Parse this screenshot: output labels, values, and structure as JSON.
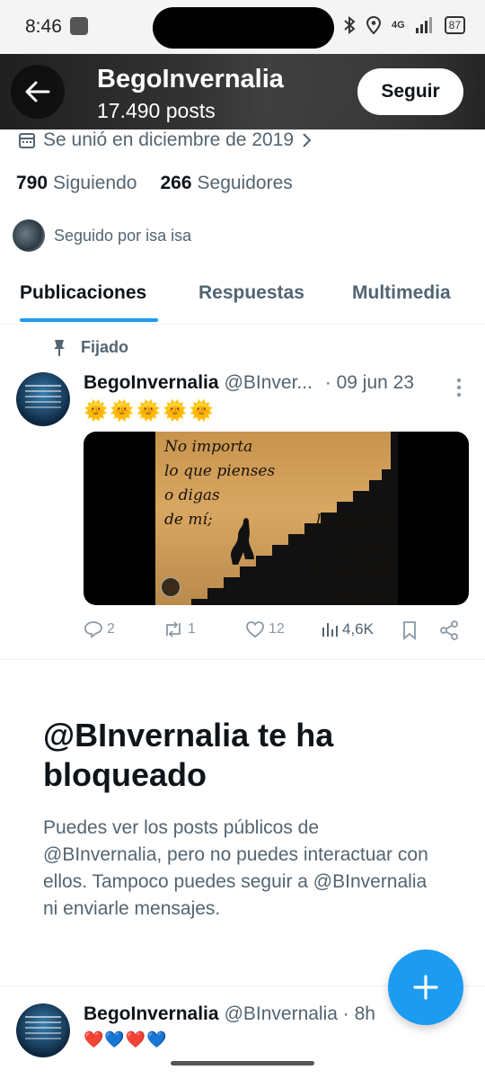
{
  "status_bar": {
    "time": "8:46",
    "battery": "87",
    "network": "4G"
  },
  "header": {
    "name": "BegoInvernalia",
    "posts": "17.490 posts",
    "follow_label": "Seguir"
  },
  "profile": {
    "joined": "Se unió en diciembre de 2019",
    "following_count": "790",
    "following_label": "Siguiendo",
    "followers_count": "266",
    "followers_label": "Seguidores",
    "followed_by": "Seguido por isa isa"
  },
  "tabs": [
    {
      "label": "Publicaciones",
      "active": true
    },
    {
      "label": "Respuestas",
      "active": false
    },
    {
      "label": "Multimedia",
      "active": false
    }
  ],
  "pinned_label": "Fijado",
  "tweet1": {
    "name": "BegoInvernalia",
    "handle": "@BInver...",
    "date": "· 09 jun 23",
    "text": "🌞🌞🌞🌞🌞",
    "image_text_left": [
      "No importa",
      "lo que pienses",
      "o digas",
      "de mí;"
    ],
    "image_text_right": [
      "la opinión",
      "es tuya,",
      "la realidad",
      "es mía."
    ],
    "replies": "2",
    "reposts": "1",
    "likes": "12",
    "views": "4,6K"
  },
  "blocked": {
    "title": "@BInvernalia te ha bloqueado",
    "body": "Puedes ver los posts públicos de @BInvernalia, pero no puedes interactuar con ellos. Tampoco puedes seguir a @BInvernalia ni enviarle mensajes."
  },
  "tweet2": {
    "name": "BegoInvernalia",
    "handle": "@BInvernalia · 8h",
    "text": "❤️💙❤️💙"
  },
  "colors": {
    "accent": "#1d9bf0",
    "text": "#0f1419",
    "muted": "#536471"
  }
}
